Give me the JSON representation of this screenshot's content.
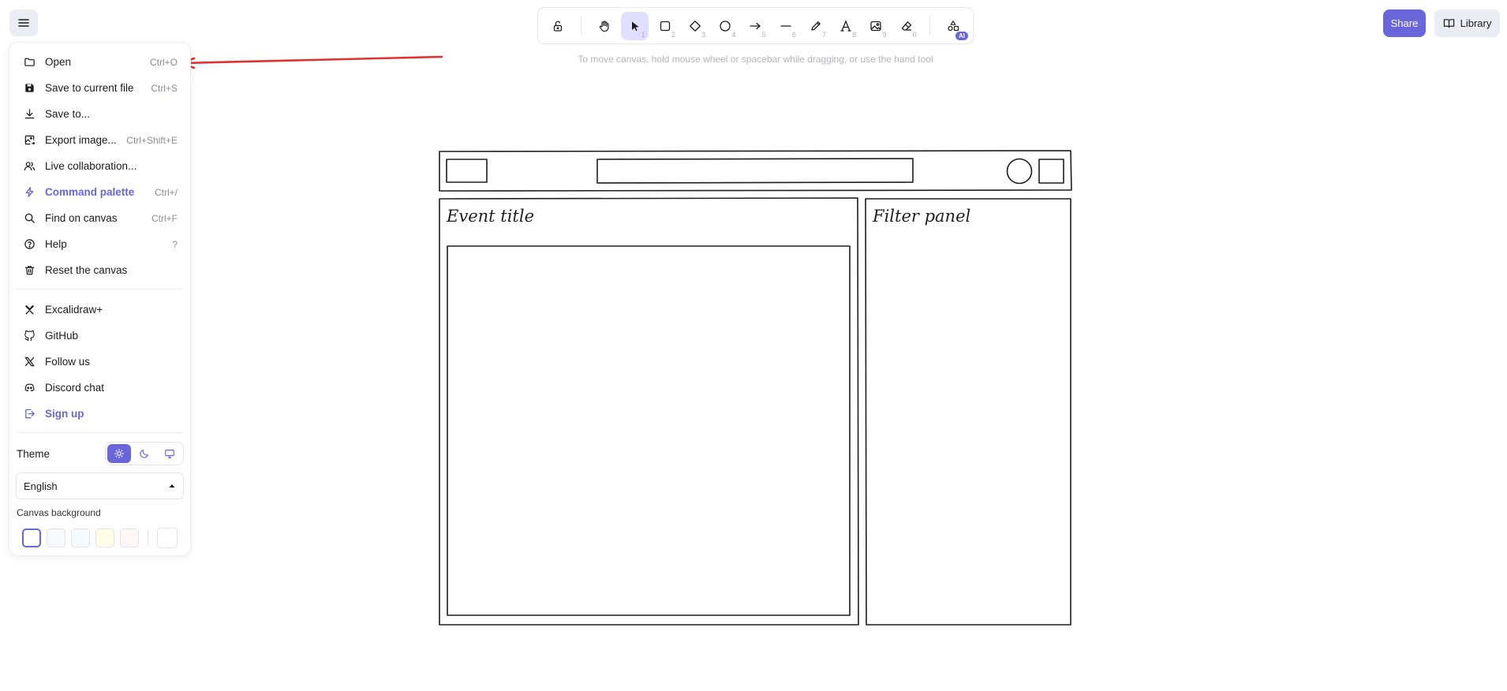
{
  "toolbar": {
    "tools": [
      {
        "name": "lock",
        "key": ""
      },
      {
        "name": "hand",
        "key": ""
      },
      {
        "name": "selection",
        "key": "1"
      },
      {
        "name": "rectangle",
        "key": "2"
      },
      {
        "name": "diamond",
        "key": "3"
      },
      {
        "name": "ellipse",
        "key": "4"
      },
      {
        "name": "arrow",
        "key": "5"
      },
      {
        "name": "line",
        "key": "6"
      },
      {
        "name": "draw",
        "key": "7"
      },
      {
        "name": "text",
        "key": "8"
      },
      {
        "name": "image",
        "key": "9"
      },
      {
        "name": "eraser",
        "key": "0"
      }
    ],
    "ai_badge": "AI"
  },
  "hint": "To move canvas, hold mouse wheel or spacebar while dragging, or use the hand tool",
  "header": {
    "share_label": "Share",
    "library_label": "Library"
  },
  "menu": {
    "items": [
      {
        "label": "Open",
        "shortcut": "Ctrl+O",
        "icon": "folder-icon"
      },
      {
        "label": "Save to current file",
        "shortcut": "Ctrl+S",
        "icon": "save-icon"
      },
      {
        "label": "Save to...",
        "shortcut": "",
        "icon": "download-icon"
      },
      {
        "label": "Export image...",
        "shortcut": "Ctrl+Shift+E",
        "icon": "export-image-icon"
      },
      {
        "label": "Live collaboration...",
        "shortcut": "",
        "icon": "users-icon"
      },
      {
        "label": "Command palette",
        "shortcut": "Ctrl+/",
        "icon": "bolt-icon"
      },
      {
        "label": "Find on canvas",
        "shortcut": "Ctrl+F",
        "icon": "search-icon"
      },
      {
        "label": "Help",
        "shortcut": "?",
        "icon": "help-icon"
      },
      {
        "label": "Reset the canvas",
        "shortcut": "",
        "icon": "trash-icon"
      }
    ],
    "links": [
      {
        "label": "Excalidraw+",
        "icon": "excalidraw-plus-icon"
      },
      {
        "label": "GitHub",
        "icon": "github-icon"
      },
      {
        "label": "Follow us",
        "icon": "x-logo-icon"
      },
      {
        "label": "Discord chat",
        "icon": "discord-icon"
      },
      {
        "label": "Sign up",
        "icon": "sign-up-icon"
      }
    ],
    "theme_label": "Theme",
    "language": "English",
    "canvas_background_label": "Canvas background",
    "background_colors": [
      "#ffffff",
      "#f8f9fa",
      "#f5faff",
      "#fffce8",
      "#fdf8f6"
    ]
  },
  "canvas": {
    "event_title": "Event title",
    "filter_panel": "Filter panel"
  },
  "colors": {
    "accent": "#6965db",
    "arrow": "#e03131"
  }
}
